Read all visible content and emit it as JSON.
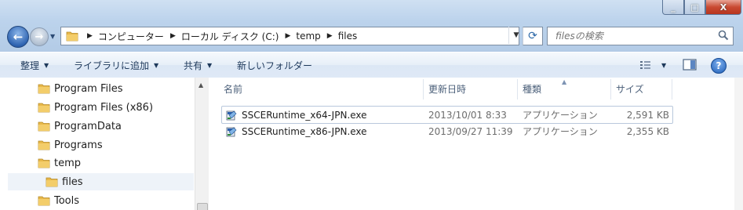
{
  "window": {
    "buttons": {
      "minimize": "_",
      "maximize": "□",
      "close": "X"
    }
  },
  "nav": {
    "back_icon": "back-arrow-icon",
    "forward_icon": "forward-arrow-icon"
  },
  "address": {
    "crumbs": [
      "コンピューター",
      "ローカル ディスク (C:)",
      "temp",
      "files"
    ]
  },
  "search": {
    "placeholder": "filesの検索"
  },
  "toolbar": {
    "organize": "整理",
    "add_to_library": "ライブラリに追加",
    "share": "共有",
    "new_folder": "新しいフォルダー"
  },
  "tree": [
    {
      "label": "Program Files"
    },
    {
      "label": "Program Files (x86)"
    },
    {
      "label": "ProgramData"
    },
    {
      "label": "Programs"
    },
    {
      "label": "temp"
    },
    {
      "label": "files",
      "selected": true
    },
    {
      "label": "Tools"
    }
  ],
  "columns": {
    "name": "名前",
    "date": "更新日時",
    "type": "種類",
    "size": "サイズ"
  },
  "files": [
    {
      "name": "SSCERuntime_x64-JPN.exe",
      "date": "2013/10/01 8:33",
      "type": "アプリケーション",
      "size": "2,591 KB",
      "selected": true
    },
    {
      "name": "SSCERuntime_x86-JPN.exe",
      "date": "2013/09/27 11:39",
      "type": "アプリケーション",
      "size": "2,355 KB",
      "selected": false
    }
  ],
  "colors": {
    "accent": "#1e395b",
    "folder": "#e8b84a",
    "selection_border": "#b9c8dc"
  }
}
